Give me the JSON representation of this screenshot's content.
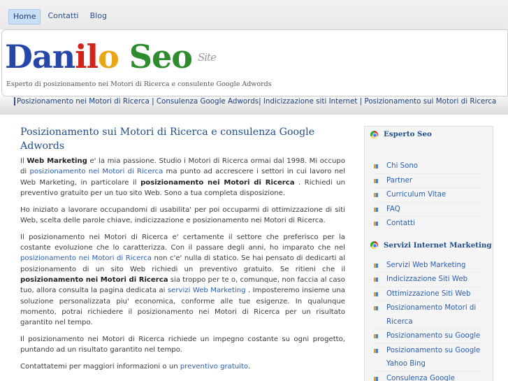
{
  "topnav": [
    {
      "label": "Home",
      "active": true
    },
    {
      "label": "Contatti",
      "active": false
    },
    {
      "label": "Blog",
      "active": false
    }
  ],
  "header": {
    "logo_parts": [
      "Dan",
      "il",
      "o ",
      "Seo"
    ],
    "logo_site": "Site",
    "tagline": "Esperto di posizionamento nei Motori di Ricerca e consulente Google Adwords"
  },
  "strip": {
    "links": [
      "Posizionamento nei Motori di Ricerca",
      "Consulenza Google Adwords",
      "Indicizzazione siti Internet",
      "Posizionamento sui Motori di Ricerca"
    ],
    "sep1": " | ",
    "sep2": "| ",
    "sep3": " | "
  },
  "main": {
    "title": "Posizionamento sui Motori di Ricerca e consulenza Google Adwords",
    "p1": {
      "t1": "Il ",
      "b1": "Web Marketing",
      "t2": " e' la mia passione. Studio i Motori di Ricerca ormai dal 1998. Mi occupo di ",
      "a1": "posizionamento nei Motori di Ricerca",
      "t3": " ma punto ad accrescere i settori in cui lavoro nel Web Marketing, in particolare il ",
      "b2": "posizionamento nei Motori di Ricerca",
      "t4": " . Richiedi un preventivo gratuito per un tuo sito Web. Sono a tua completa disposizione."
    },
    "p2": "Ho iniziato a lavorare occupandomi di usabilita' per poi occuparmi di ottimizzazione di siti Web, scelta delle parole chiave, indicizzazione e posizionamento nei Motori di Ricerca.",
    "p3": {
      "t1": "Il posizionamento nei Motori di Ricerca e' certamente il settore che preferisco per la costante evoluzione che lo caratterizza. Con il passare degli anni, ho imparato che nel ",
      "a1": "posizionamento nei Motori di Ricerca",
      "t2": " non c'e' nulla di statico. Se hai pensato di dedicarti al posizionamento di un sito Web richiedi un preventivo gratuito. Se ritieni che il ",
      "b1": "posizionamento nei Motori di Ricerca",
      "t3": " sia troppo per te o, comunque, non faccia al caso tuo, allora consulta la pagina dedicata ai ",
      "a2": "servizi Web Marketing",
      "t4": " . Imposteremo insieme una soluzione personalizzata piu' economica, conforme alle tue esigenze. In qualunque momento, potrai richiedere il posizionamento nei Motori di Ricerca per un risultato garantito nel tempo."
    },
    "p4": "Il posizionamento nei Motori di Ricerca richiede un impegno costante su ogni progetto, puntando ad un risultato garantito nel tempo.",
    "p5": {
      "t1": "Contattatemi per maggiori informazioni o un ",
      "a1": "preventivo gratuito",
      "t2": "."
    }
  },
  "sidebar": {
    "section1_title": "Esperto Seo",
    "section1_items": [
      "Chi Sono",
      "Partner",
      "Curriculum Vitae",
      "FAQ",
      "Contatti"
    ],
    "section2_title": "Servizi Internet Marketing",
    "section2_items": [
      "Servizi Web Marketing",
      "Indicizzazione Siti Web",
      "Ottimizzazione Siti Web",
      "Posizionamento Motori di Ricerca",
      "Posizionamento su Google",
      "Posizionamento su Google Yahoo Bing",
      "Consulenza Google Adwords"
    ]
  },
  "colors": {
    "link": "#2a5db0",
    "heading": "#1f4c8a",
    "logo_blue": "#2548a8",
    "logo_red": "#d2241b",
    "logo_yellow": "#e8a514",
    "logo_green": "#2e8b2e"
  }
}
